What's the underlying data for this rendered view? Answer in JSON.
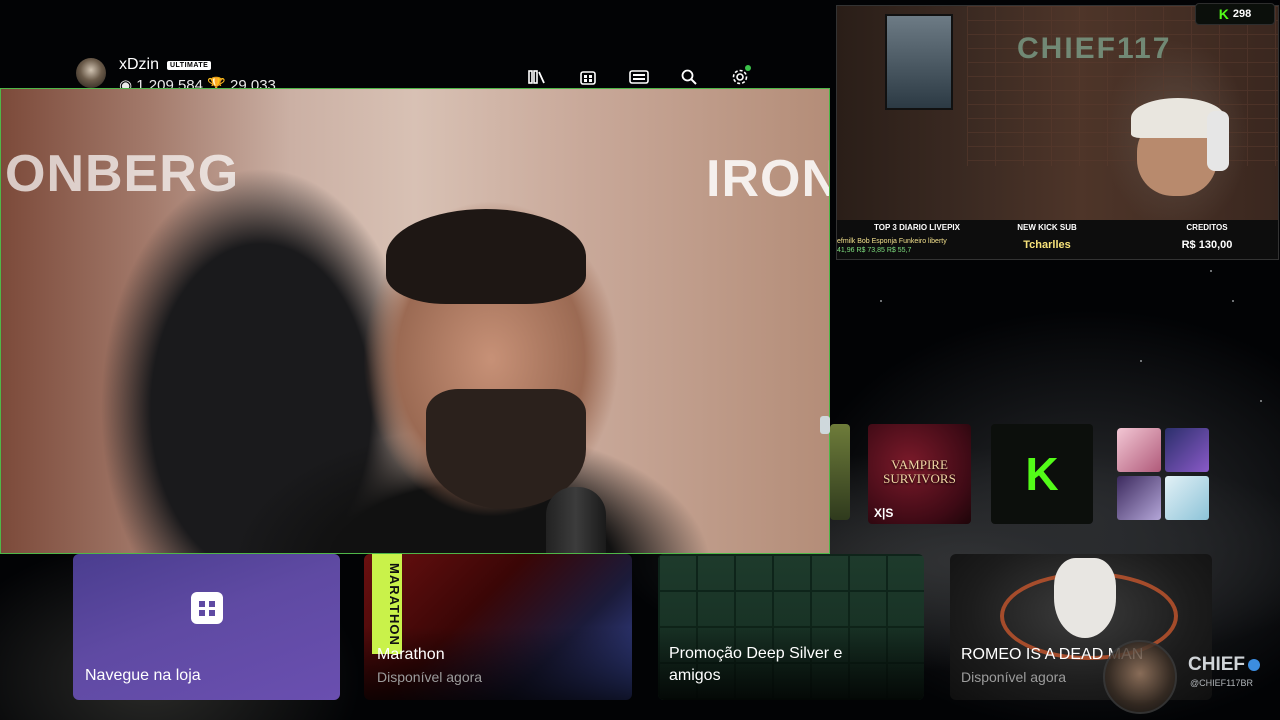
{
  "profile": {
    "gamertag": "xDzin",
    "badge": "ULTIMATE",
    "stats_text": "◉ 1.209.584  🏆 29.033"
  },
  "nav": {
    "icons": [
      "library-icon",
      "store-icon",
      "game-pass-icon",
      "search-icon",
      "settings-icon"
    ],
    "notification_color": "#3ac24a"
  },
  "pip_video": {
    "sign_left": "ONBERG",
    "sign_right": "IRON"
  },
  "stream_overlay": {
    "kick_count": "298",
    "logo_text": "CHIEF117",
    "ticker": {
      "top3_title": "TOP 3 DIARIO LIVEPIX",
      "top3_names": "efmilk  Bob Esponja Funkeiro  liberty",
      "top3_values": "41,96   R$ 73,85   R$ 55,7",
      "sub_title": "NEW KICK SUB",
      "sub_name": "Tcharlles",
      "credits_title": "CREDITOS",
      "credits_value": "R$ 130,00"
    }
  },
  "right_tiles": {
    "vampire_title_1": "VAMPIRE",
    "vampire_title_2": "SURVIVORS",
    "vampire_badge": "X|S",
    "kick_letter": "K"
  },
  "cards": {
    "store_label": "Navegue na loja",
    "marathon_strip": "MARATHON",
    "marathon_title": "Marathon",
    "marathon_sub": "Disponível agora",
    "deep_title_1": "Promoção Deep Silver e",
    "deep_title_2": "amigos",
    "romeo_title": "ROMEO IS A DEAD MAN",
    "romeo_sub": "Disponível agora"
  },
  "watermark": {
    "name": "CHIEF",
    "handle": "@CHIEF117BR"
  },
  "colors": {
    "kick_green": "#53fc18",
    "pip_border": "#4fb748",
    "store_purple": "#5f4aa3"
  }
}
